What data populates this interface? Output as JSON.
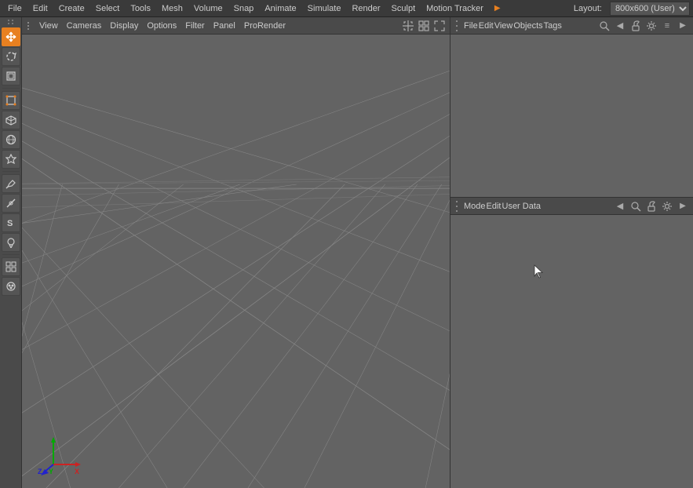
{
  "menubar": {
    "items": [
      "File",
      "Edit",
      "Create",
      "Select",
      "Tools",
      "Mesh",
      "Volume",
      "Snap",
      "Animate",
      "Simulate",
      "Render",
      "Sculpt",
      "Motion Tracker"
    ],
    "layout_label": "Layout:",
    "layout_value": "800x600 (User)"
  },
  "viewport": {
    "toolbar_items": [
      "View",
      "Cameras",
      "Display",
      "Options",
      "Filter",
      "Panel",
      "ProRender"
    ]
  },
  "obj_manager": {
    "toolbar_items": [
      "File",
      "Edit",
      "View",
      "Objects",
      "Tags"
    ]
  },
  "attr_panel": {
    "toolbar_items": [
      "Mode",
      "Edit",
      "User Data"
    ]
  },
  "tools": [
    {
      "name": "move",
      "icon": "✛"
    },
    {
      "name": "rotate",
      "icon": "↻"
    },
    {
      "name": "scale",
      "icon": "⤢"
    },
    {
      "name": "select",
      "icon": "▣"
    },
    {
      "name": "cube",
      "icon": "◻"
    },
    {
      "name": "sphere",
      "icon": "○"
    },
    {
      "name": "object",
      "icon": "⬡"
    },
    {
      "name": "pen",
      "icon": "✏"
    },
    {
      "name": "knife",
      "icon": "⊸"
    },
    {
      "name": "magnet",
      "icon": "S"
    },
    {
      "name": "brush",
      "icon": "⊛"
    },
    {
      "name": "grid",
      "icon": "▦"
    },
    {
      "name": "paint",
      "icon": "◈"
    }
  ],
  "colors": {
    "bg_dark": "#3a3a3a",
    "bg_mid": "#4a4a4a",
    "bg_light": "#636363",
    "bg_viewport": "#636363",
    "accent": "#e88020",
    "text": "#cccccc",
    "border": "#333333"
  }
}
